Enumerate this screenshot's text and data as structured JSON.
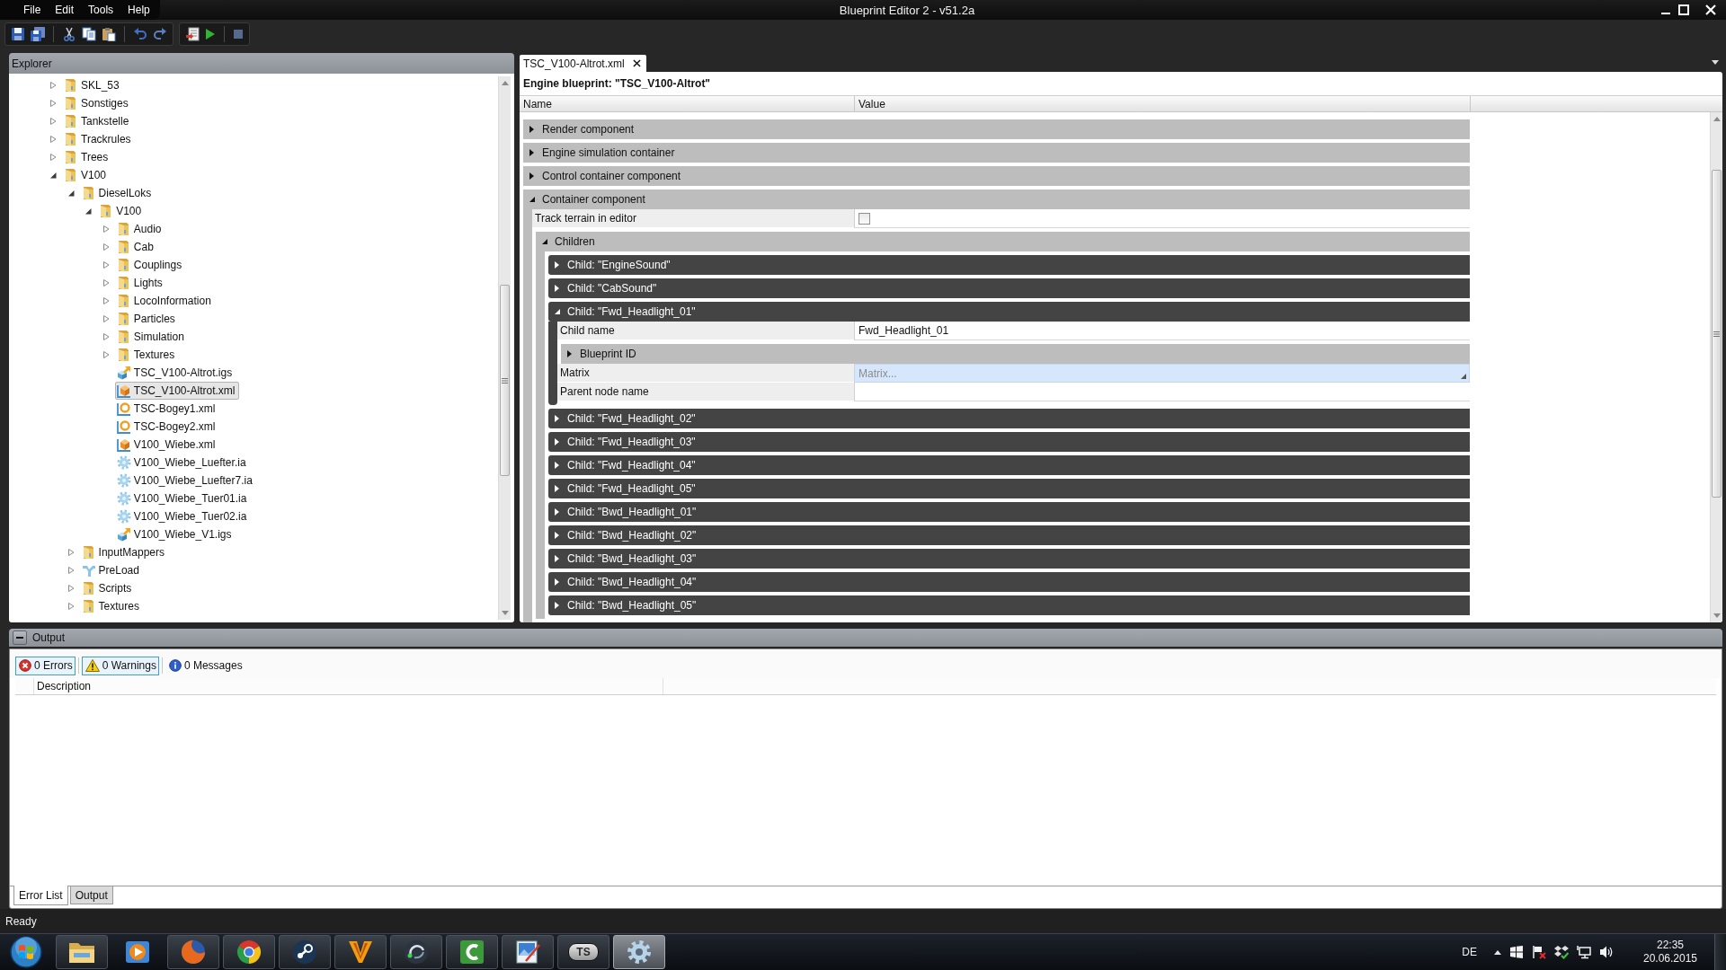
{
  "window": {
    "title": "Blueprint Editor 2 - v51.2a"
  },
  "menu": [
    "File",
    "Edit",
    "Tools",
    "Help"
  ],
  "explorer": {
    "title": "Explorer",
    "items": [
      {
        "label": "SKL_53",
        "kind": "folder",
        "expanded": false,
        "selected": false
      },
      {
        "label": "Sonstiges",
        "kind": "folder",
        "expanded": false,
        "selected": false
      },
      {
        "label": "Tankstelle",
        "kind": "folder",
        "expanded": false,
        "selected": false
      },
      {
        "label": "Trackrules",
        "kind": "folder",
        "expanded": false,
        "selected": false
      },
      {
        "label": "Trees",
        "kind": "folder",
        "expanded": false,
        "selected": false
      },
      {
        "label": "V100",
        "kind": "folder",
        "expanded": true,
        "selected": false,
        "children": [
          {
            "label": "DieselLoks",
            "kind": "folder",
            "expanded": true,
            "selected": false,
            "children": [
              {
                "label": "V100",
                "kind": "folder",
                "expanded": true,
                "selected": false,
                "children": [
                  {
                    "label": "Audio",
                    "kind": "folder",
                    "expanded": false,
                    "selected": false
                  },
                  {
                    "label": "Cab",
                    "kind": "folder",
                    "expanded": false,
                    "selected": false
                  },
                  {
                    "label": "Couplings",
                    "kind": "folder",
                    "expanded": false,
                    "selected": false
                  },
                  {
                    "label": "Lights",
                    "kind": "folder",
                    "expanded": false,
                    "selected": false
                  },
                  {
                    "label": "LocoInformation",
                    "kind": "folder",
                    "expanded": false,
                    "selected": false
                  },
                  {
                    "label": "Particles",
                    "kind": "folder",
                    "expanded": false,
                    "selected": false
                  },
                  {
                    "label": "Simulation",
                    "kind": "folder",
                    "expanded": false,
                    "selected": false
                  },
                  {
                    "label": "Textures",
                    "kind": "folder",
                    "expanded": false,
                    "selected": false
                  },
                  {
                    "label": "TSC_V100-Altrot.igs",
                    "kind": "igs",
                    "selected": false
                  },
                  {
                    "label": "TSC_V100-Altrot.xml",
                    "kind": "blueprint",
                    "selected": true
                  },
                  {
                    "label": "TSC-Bogey1.xml",
                    "kind": "bogey",
                    "selected": false
                  },
                  {
                    "label": "TSC-Bogey2.xml",
                    "kind": "bogey",
                    "selected": false
                  },
                  {
                    "label": "V100_Wiebe.xml",
                    "kind": "blueprint",
                    "selected": false
                  },
                  {
                    "label": "V100_Wiebe_Luefter.ia",
                    "kind": "animation",
                    "selected": false
                  },
                  {
                    "label": "V100_Wiebe_Luefter7.ia",
                    "kind": "animation",
                    "selected": false
                  },
                  {
                    "label": "V100_Wiebe_Tuer01.ia",
                    "kind": "animation",
                    "selected": false
                  },
                  {
                    "label": "V100_Wiebe_Tuer02.ia",
                    "kind": "animation",
                    "selected": false
                  },
                  {
                    "label": "V100_Wiebe_V1.igs",
                    "kind": "igs",
                    "selected": false
                  }
                ]
              }
            ]
          },
          {
            "label": "InputMappers",
            "kind": "folder",
            "expanded": false,
            "selected": false
          },
          {
            "label": "PreLoad",
            "kind": "preload",
            "expanded": false,
            "selected": false
          },
          {
            "label": "Scripts",
            "kind": "folder",
            "expanded": false,
            "selected": false
          },
          {
            "label": "Textures",
            "kind": "folder",
            "expanded": false,
            "selected": false
          }
        ]
      }
    ]
  },
  "document": {
    "tabs": [
      {
        "label": "TSC_V100-Altrot.xml",
        "selected": true
      }
    ],
    "heading": "Engine blueprint: \"TSC_V100-Altrot\"",
    "columns": [
      "Name",
      "Value"
    ],
    "rows": [
      {
        "kind": "category",
        "label": "Render component",
        "expanded": false
      },
      {
        "kind": "category",
        "label": "Engine simulation container",
        "expanded": false
      },
      {
        "kind": "category",
        "label": "Control container component",
        "expanded": false
      },
      {
        "kind": "category",
        "label": "Container component",
        "expanded": true,
        "children": [
          {
            "kind": "checkbox",
            "label": "Track terrain in editor",
            "checked": false
          },
          {
            "kind": "category",
            "label": "Children",
            "expanded": true,
            "children": [
              {
                "kind": "child",
                "label": "Child: \"EngineSound\"",
                "expanded": false
              },
              {
                "kind": "child",
                "label": "Child: \"CabSound\"",
                "expanded": false
              },
              {
                "kind": "child",
                "label": "Child: \"Fwd_Headlight_01\"",
                "expanded": true,
                "children": [
                  {
                    "kind": "text",
                    "label": "Child name",
                    "value": "Fwd_Headlight_01"
                  },
                  {
                    "kind": "category",
                    "label": "Blueprint ID",
                    "expanded": false
                  },
                  {
                    "kind": "dialog",
                    "label": "Matrix",
                    "value": "Matrix..."
                  },
                  {
                    "kind": "text",
                    "label": "Parent node name"
                  }
                ]
              },
              {
                "kind": "child",
                "label": "Child: \"Fwd_Headlight_02\"",
                "expanded": false
              },
              {
                "kind": "child",
                "label": "Child: \"Fwd_Headlight_03\"",
                "expanded": false
              },
              {
                "kind": "child",
                "label": "Child: \"Fwd_Headlight_04\"",
                "expanded": false
              },
              {
                "kind": "child",
                "label": "Child: \"Fwd_Headlight_05\"",
                "expanded": false
              },
              {
                "kind": "child",
                "label": "Child: \"Bwd_Headlight_01\"",
                "expanded": false
              },
              {
                "kind": "child",
                "label": "Child: \"Bwd_Headlight_02\"",
                "expanded": false
              },
              {
                "kind": "child",
                "label": "Child: \"Bwd_Headlight_03\"",
                "expanded": false
              },
              {
                "kind": "child",
                "label": "Child: \"Bwd_Headlight_04\"",
                "expanded": false
              },
              {
                "kind": "child",
                "label": "Child: \"Bwd_Headlight_05\"",
                "expanded": false
              }
            ]
          }
        ]
      }
    ]
  },
  "output_panel": {
    "title": "Output",
    "filters": [
      {
        "kind": "error",
        "label": "0 Errors",
        "on": true
      },
      {
        "kind": "warning",
        "label": "0 Warnings",
        "on": true
      },
      {
        "kind": "info",
        "label": "0 Messages",
        "on": false
      }
    ],
    "columns": [
      "Description"
    ],
    "tabs": [
      {
        "label": "Error List",
        "selected": true
      },
      {
        "label": "Output",
        "selected": false
      }
    ]
  },
  "status_bar": {
    "text": "Ready"
  },
  "taskbar": {
    "apps": [
      {
        "kind": "folder",
        "running": true,
        "selected": false
      },
      {
        "kind": "play",
        "running": false,
        "selected": false
      },
      {
        "kind": "globe",
        "running": true,
        "selected": false
      },
      {
        "kind": "wheel",
        "running": true,
        "selected": false
      },
      {
        "kind": "piston",
        "running": true,
        "selected": false
      },
      {
        "kind": "vee",
        "running": true,
        "selected": false
      },
      {
        "kind": "headset",
        "running": true,
        "selected": false
      },
      {
        "kind": "arc",
        "running": true,
        "selected": false
      },
      {
        "kind": "picture",
        "running": true,
        "selected": false
      },
      {
        "kind": "badge",
        "label": "TS",
        "running": true,
        "selected": false
      },
      {
        "kind": "gear",
        "running": true,
        "selected": true
      }
    ],
    "language": "DE",
    "time": "22:35",
    "date": "20.06.2015"
  }
}
